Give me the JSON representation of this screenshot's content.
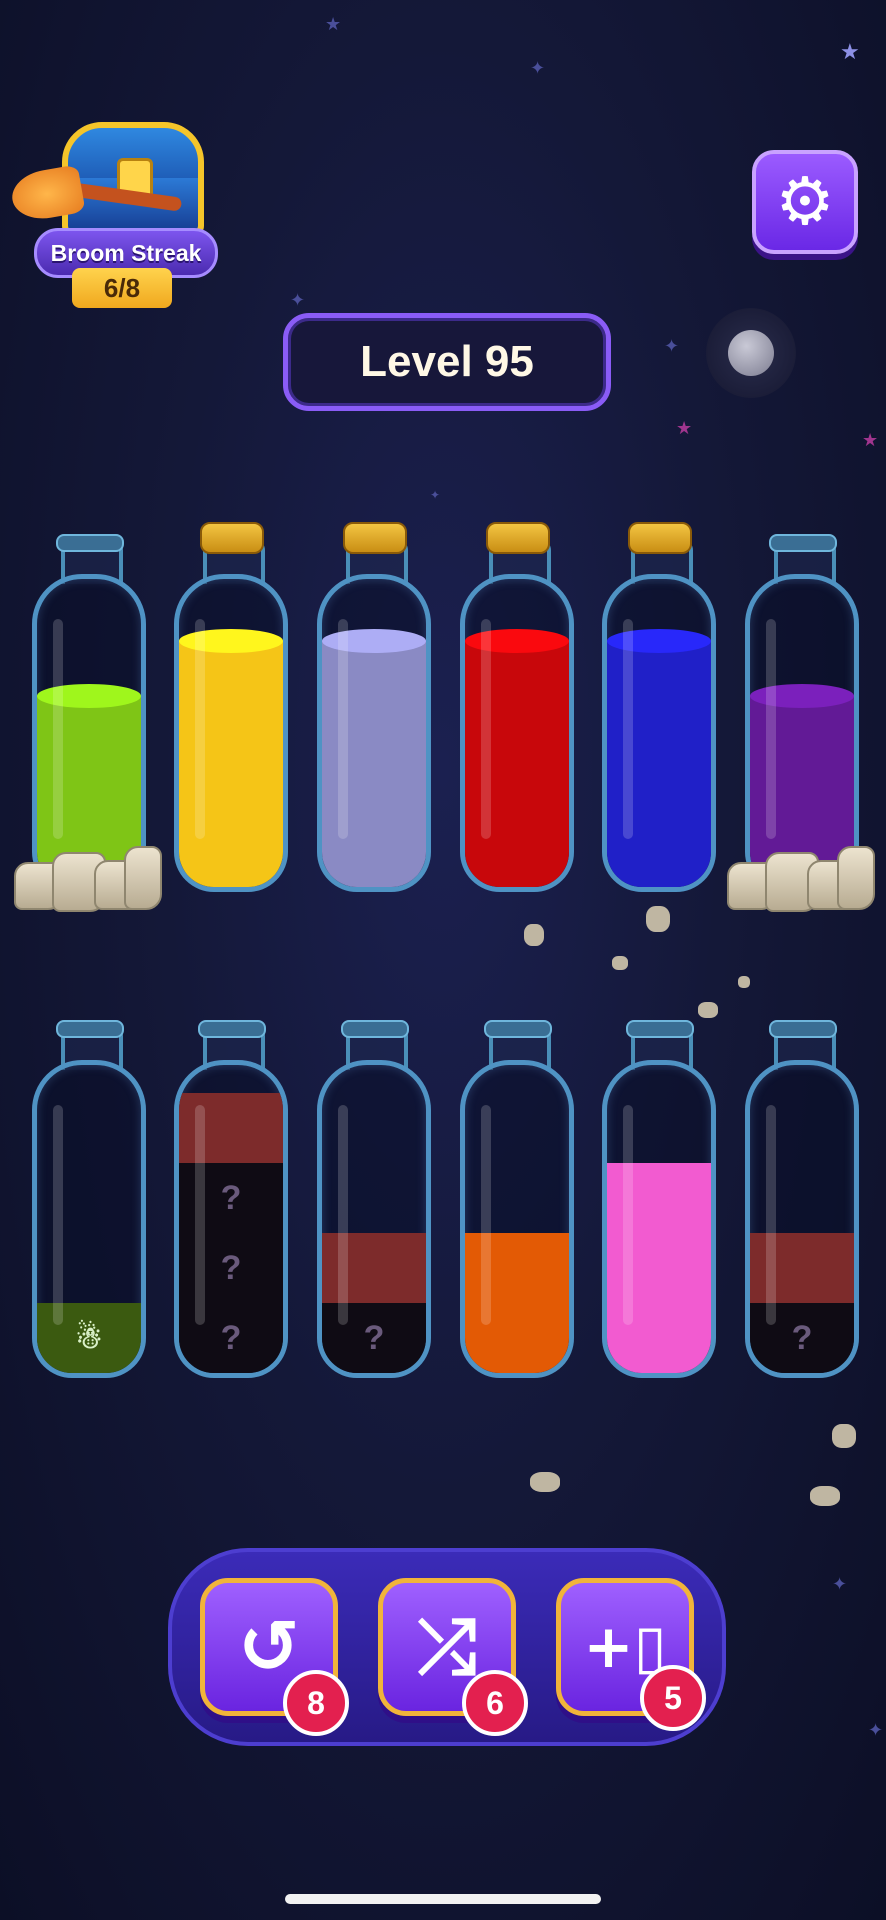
{
  "streak": {
    "label": "Broom Streak",
    "count": "6/8"
  },
  "level": {
    "label": "Level 95"
  },
  "settings": {
    "icon": "gear-icon"
  },
  "colors": {
    "lime": "#7fc516",
    "yellow": "#f5c517",
    "lavender": "#8a8ac4",
    "red": "#c8070b",
    "blue": "#2020c8",
    "purple": "#621a96",
    "maroon": "#7d2b2b",
    "dark": "#0f0b14",
    "olive": "#3b5a10",
    "orange": "#e35a05",
    "pink": "#f25bd0"
  },
  "bottles_row1": [
    {
      "color": "lime",
      "fill": 0.62,
      "corked": false,
      "rocks": true
    },
    {
      "color": "yellow",
      "fill": 0.8,
      "corked": true,
      "rocks": false
    },
    {
      "color": "lavender",
      "fill": 0.8,
      "corked": true,
      "rocks": false
    },
    {
      "color": "red",
      "fill": 0.8,
      "corked": true,
      "rocks": false
    },
    {
      "color": "blue",
      "fill": 0.8,
      "corked": true,
      "rocks": false
    },
    {
      "color": "purple",
      "fill": 0.62,
      "corked": false,
      "rocks": true
    }
  ],
  "bottles_row2": [
    {
      "segments": [
        {
          "color": "olive",
          "mark": "",
          "icon": "ghost-icon"
        }
      ]
    },
    {
      "segments": [
        {
          "color": "dark",
          "mark": "?"
        },
        {
          "color": "dark",
          "mark": "?"
        },
        {
          "color": "dark",
          "mark": "?"
        },
        {
          "color": "maroon",
          "mark": ""
        }
      ]
    },
    {
      "segments": [
        {
          "color": "dark",
          "mark": "?"
        },
        {
          "color": "maroon",
          "mark": ""
        }
      ]
    },
    {
      "segments": [
        {
          "color": "orange",
          "mark": ""
        },
        {
          "color": "orange",
          "mark": ""
        }
      ]
    },
    {
      "segments": [
        {
          "color": "pink",
          "mark": ""
        },
        {
          "color": "pink",
          "mark": ""
        },
        {
          "color": "pink",
          "mark": ""
        }
      ]
    },
    {
      "segments": [
        {
          "color": "dark",
          "mark": "?"
        },
        {
          "color": "maroon",
          "mark": ""
        }
      ]
    }
  ],
  "tools": [
    {
      "name": "undo",
      "icon": "undo-icon",
      "count": "8"
    },
    {
      "name": "shuffle",
      "icon": "shuffle-icon",
      "count": "6"
    },
    {
      "name": "add-bottle",
      "icon": "add-bottle-icon",
      "count": "5"
    }
  ]
}
